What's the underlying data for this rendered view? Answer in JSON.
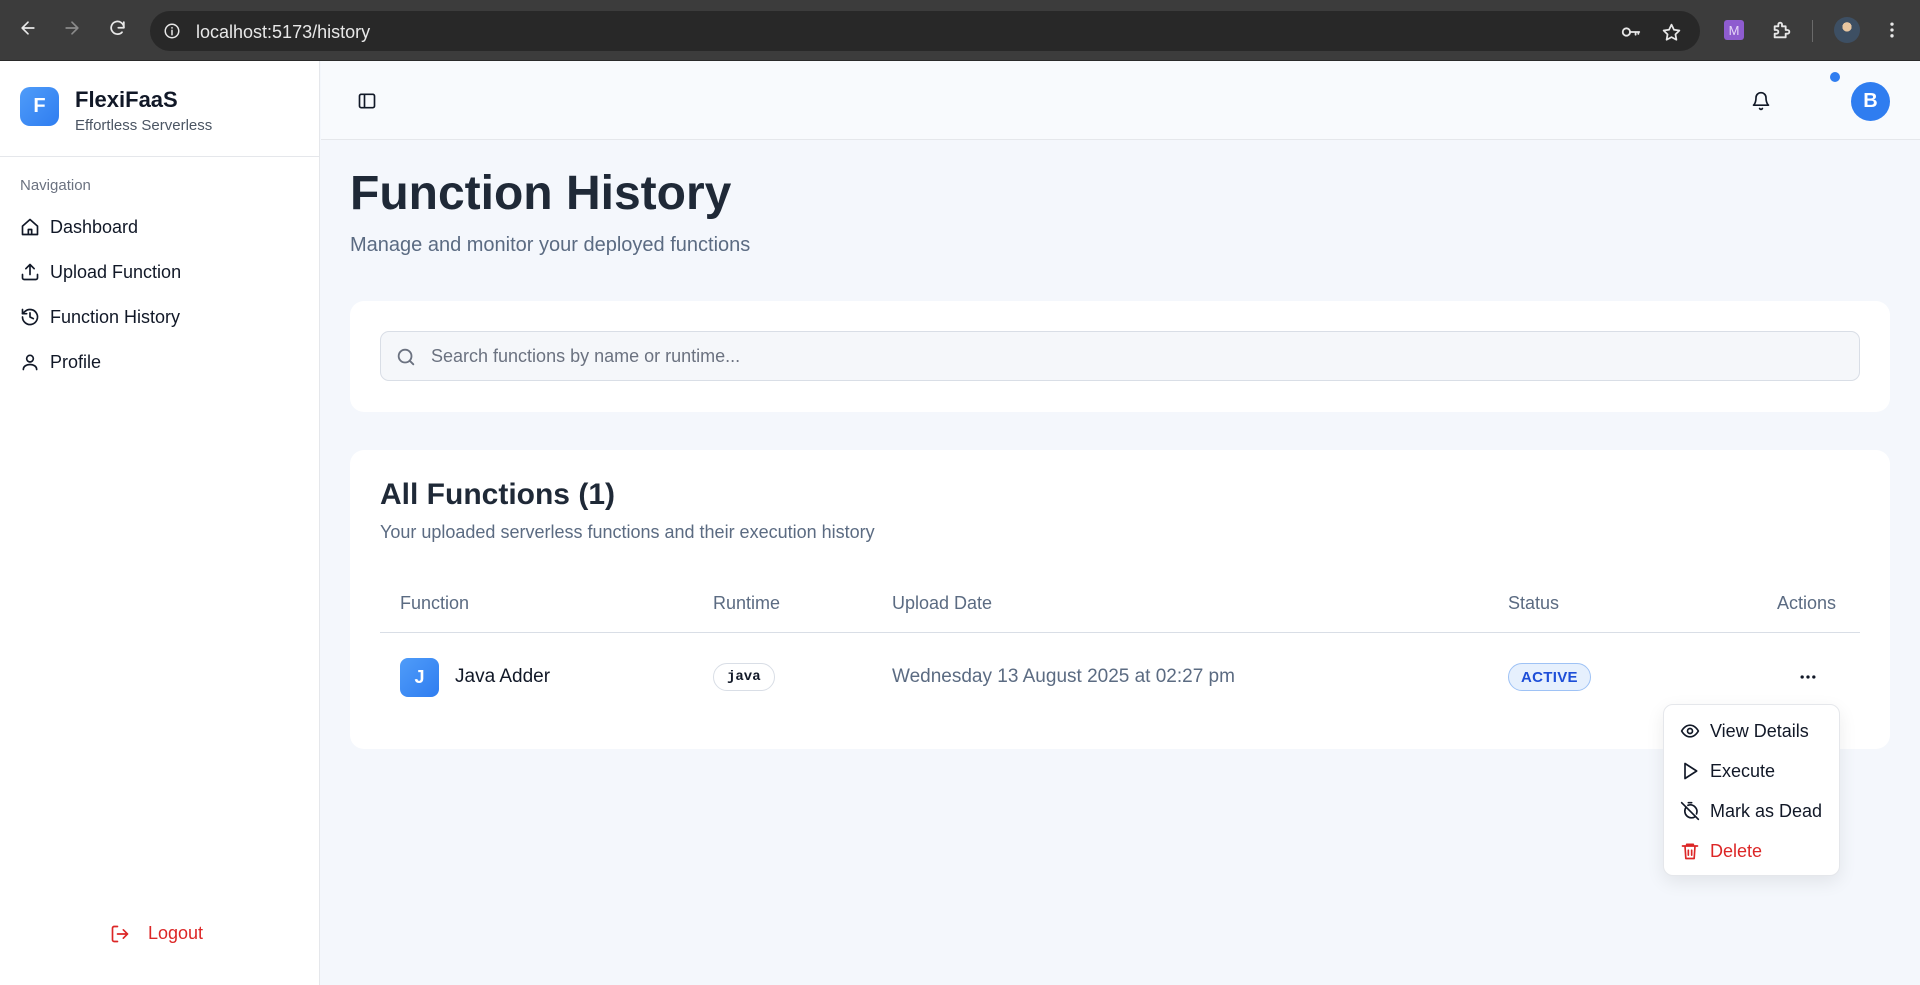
{
  "browser": {
    "url": "localhost:5173/history",
    "extension_letter": "M"
  },
  "sidebar": {
    "brand_letter": "F",
    "brand_name": "FlexiFaaS",
    "brand_tagline": "Effortless Serverless",
    "nav_heading": "Navigation",
    "items": [
      {
        "label": "Dashboard",
        "icon": "home-icon"
      },
      {
        "label": "Upload Function",
        "icon": "upload-icon"
      },
      {
        "label": "Function History",
        "icon": "history-icon"
      },
      {
        "label": "Profile",
        "icon": "user-icon"
      }
    ],
    "logout_label": "Logout"
  },
  "header": {
    "avatar_letter": "B",
    "has_notification": true
  },
  "page": {
    "title": "Function History",
    "subtitle": "Manage and monitor your deployed functions"
  },
  "search": {
    "placeholder": "Search functions by name or runtime...",
    "value": ""
  },
  "functions": {
    "title": "All Functions (1)",
    "subtitle": "Your uploaded serverless functions and their execution history",
    "columns": [
      "Function",
      "Runtime",
      "Upload Date",
      "Status",
      "Actions"
    ],
    "rows": [
      {
        "initial": "J",
        "name": "Java Adder",
        "runtime": "java",
        "upload_date": "Wednesday 13 August 2025 at 02:27 pm",
        "status": "ACTIVE"
      }
    ]
  },
  "actions_menu": {
    "items": [
      {
        "label": "View Details",
        "icon": "eye-icon"
      },
      {
        "label": "Execute",
        "icon": "play-icon"
      },
      {
        "label": "Mark as Dead",
        "icon": "timer-off-icon"
      },
      {
        "label": "Delete",
        "icon": "trash-icon"
      }
    ]
  },
  "colors": {
    "accent": "#2f7df0",
    "danger": "#dc2626",
    "status_active_bg": "#e6f0fd",
    "status_active_text": "#1d4ed8"
  }
}
